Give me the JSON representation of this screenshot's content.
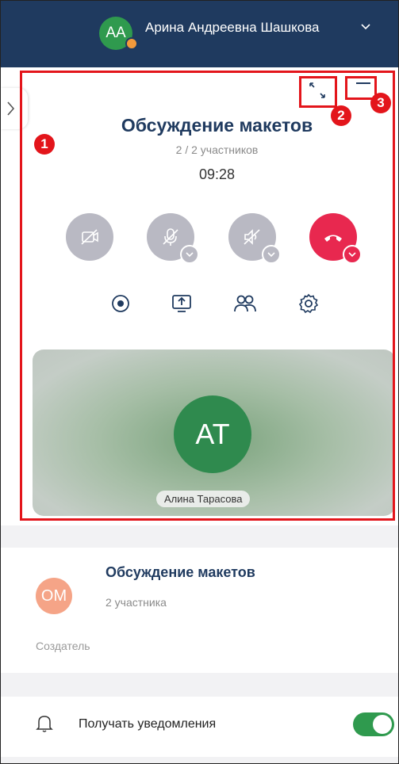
{
  "header": {
    "avatar_initials": "AA",
    "user_name": "Арина Андреевна Шашкова"
  },
  "call": {
    "title": "Обсуждение макетов",
    "participants": "2 / 2 участников",
    "timer": "09:28",
    "controls": [
      "camera-off-icon",
      "mic-off-icon",
      "speaker-off-icon",
      "hang-up-icon"
    ],
    "tools": [
      "record-icon",
      "screen-share-icon",
      "participants-icon",
      "settings-icon"
    ],
    "video_initials": "AT",
    "video_name": "Алина Тарасова"
  },
  "annotations": {
    "badge_1": "1",
    "badge_2": "2",
    "badge_3": "3"
  },
  "chat": {
    "avatar_initials": "OM",
    "title": "Обсуждение макетов",
    "members": "2 участника",
    "creator_label": "Создатель"
  },
  "notifications": {
    "label": "Получать уведомления",
    "enabled": true
  },
  "colors": {
    "header_bg": "#1f3a5f",
    "accent_green": "#2f9a4e",
    "hangup_red": "#e8284f",
    "annotation_red": "#e3151b"
  }
}
